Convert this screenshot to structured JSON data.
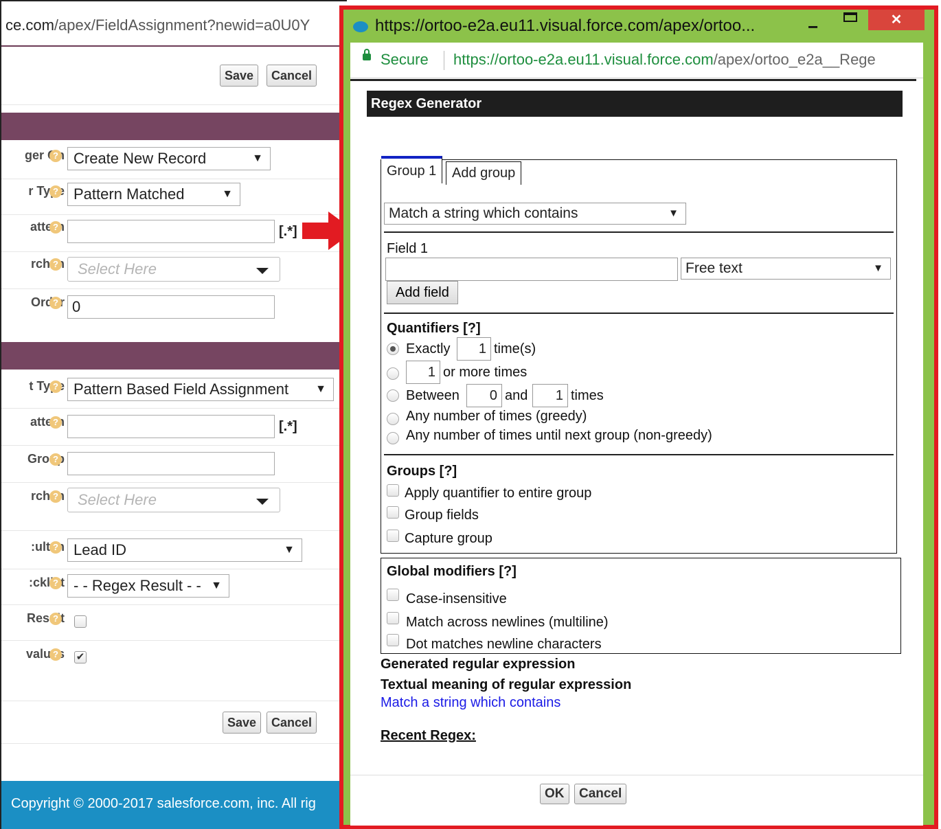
{
  "background_page": {
    "url_domain": "ce.com",
    "url_path": "/apex/FieldAssignment?newid=a0U0Y",
    "top_save": "Save",
    "top_cancel": "Cancel",
    "section1_rows": [
      {
        "label": "ger On",
        "value": "Create New Record"
      },
      {
        "label": "r Type",
        "value": "Pattern Matched"
      },
      {
        "label": "attern",
        "value": "",
        "suffix": "[.*]"
      },
      {
        "label": "rch In",
        "placeholder": "Select Here"
      },
      {
        "label": "Order",
        "value": "0"
      }
    ],
    "section2_rows": [
      {
        "label": "t Type",
        "value": "Pattern Based Field Assignment"
      },
      {
        "label": "attern",
        "value": "",
        "suffix": "[.*]"
      },
      {
        "label": "Group",
        "value": ""
      },
      {
        "label": "rch In",
        "placeholder": "Select Here"
      },
      {
        "label": "ult in:",
        "value": "Lead ID"
      },
      {
        "label": "cklist:",
        "value": "- - Regex Result - -"
      },
      {
        "label": "Result",
        "checked": false
      },
      {
        "label": "values",
        "checked": true
      }
    ],
    "bottom_save": "Save",
    "bottom_cancel": "Cancel",
    "footer": "Copyright © 2000-2017 salesforce.com, inc. All rig",
    "help_glyph": "?",
    "arrow_glyph": "▼",
    "check_glyph": "✔"
  },
  "popup": {
    "window_title": "https://ortoo-e2a.eu11.visual.force.com/apex/ortoo...",
    "minimize": "−",
    "close": "✕",
    "secure_label": "Secure",
    "address_domain": "https://ortoo-e2a.eu11.visual.force.com",
    "address_path": "/apex/ortoo_e2a__Rege",
    "header": "Regex Generator",
    "tabs": [
      "Group 1",
      "Add group"
    ],
    "match_select": "Match a string which contains",
    "field_label": "Field 1",
    "field_value": "",
    "field_type": "Free text",
    "add_field": "Add field",
    "quantifiers": {
      "title": "Quantifiers [?]",
      "exactly_label": "Exactly",
      "exactly_value": "1",
      "times_s": "time(s)",
      "or_more_value": "1",
      "or_more_label": "or more times",
      "between_label": "Between",
      "between_min": "0",
      "and_label": "and",
      "between_max": "1",
      "times_label": "times",
      "greedy": "Any number of times (greedy)",
      "non_greedy": "Any number of times until next group (non-greedy)"
    },
    "groups": {
      "title": "Groups [?]",
      "options": [
        "Apply quantifier to entire group",
        "Group fields",
        "Capture group"
      ]
    },
    "global": {
      "title": "Global modifiers [?]",
      "options": [
        "Case-insensitive",
        "Match across newlines (multiline)",
        "Dot matches newline characters"
      ]
    },
    "generated_label": "Generated regular expression",
    "textual_label": "Textual meaning of regular expression",
    "textual_value": "Match a string which contains",
    "recent_label": "Recent Regex:",
    "ok": "OK",
    "cancel": "Cancel"
  },
  "colors": {
    "frame_red": "#e21b22",
    "window_green": "#8cc24a",
    "section_purple": "#764561",
    "footer_blue": "#1b8fc4",
    "link_blue": "#1a1ae6",
    "tab_blue": "#1223c4"
  },
  "icons": [
    "favicon-cloud-icon",
    "lock-icon",
    "help-icon",
    "dropdown-arrow-icon",
    "red-arrow-icon",
    "close-icon",
    "minimize-icon",
    "maximize-icon"
  ]
}
